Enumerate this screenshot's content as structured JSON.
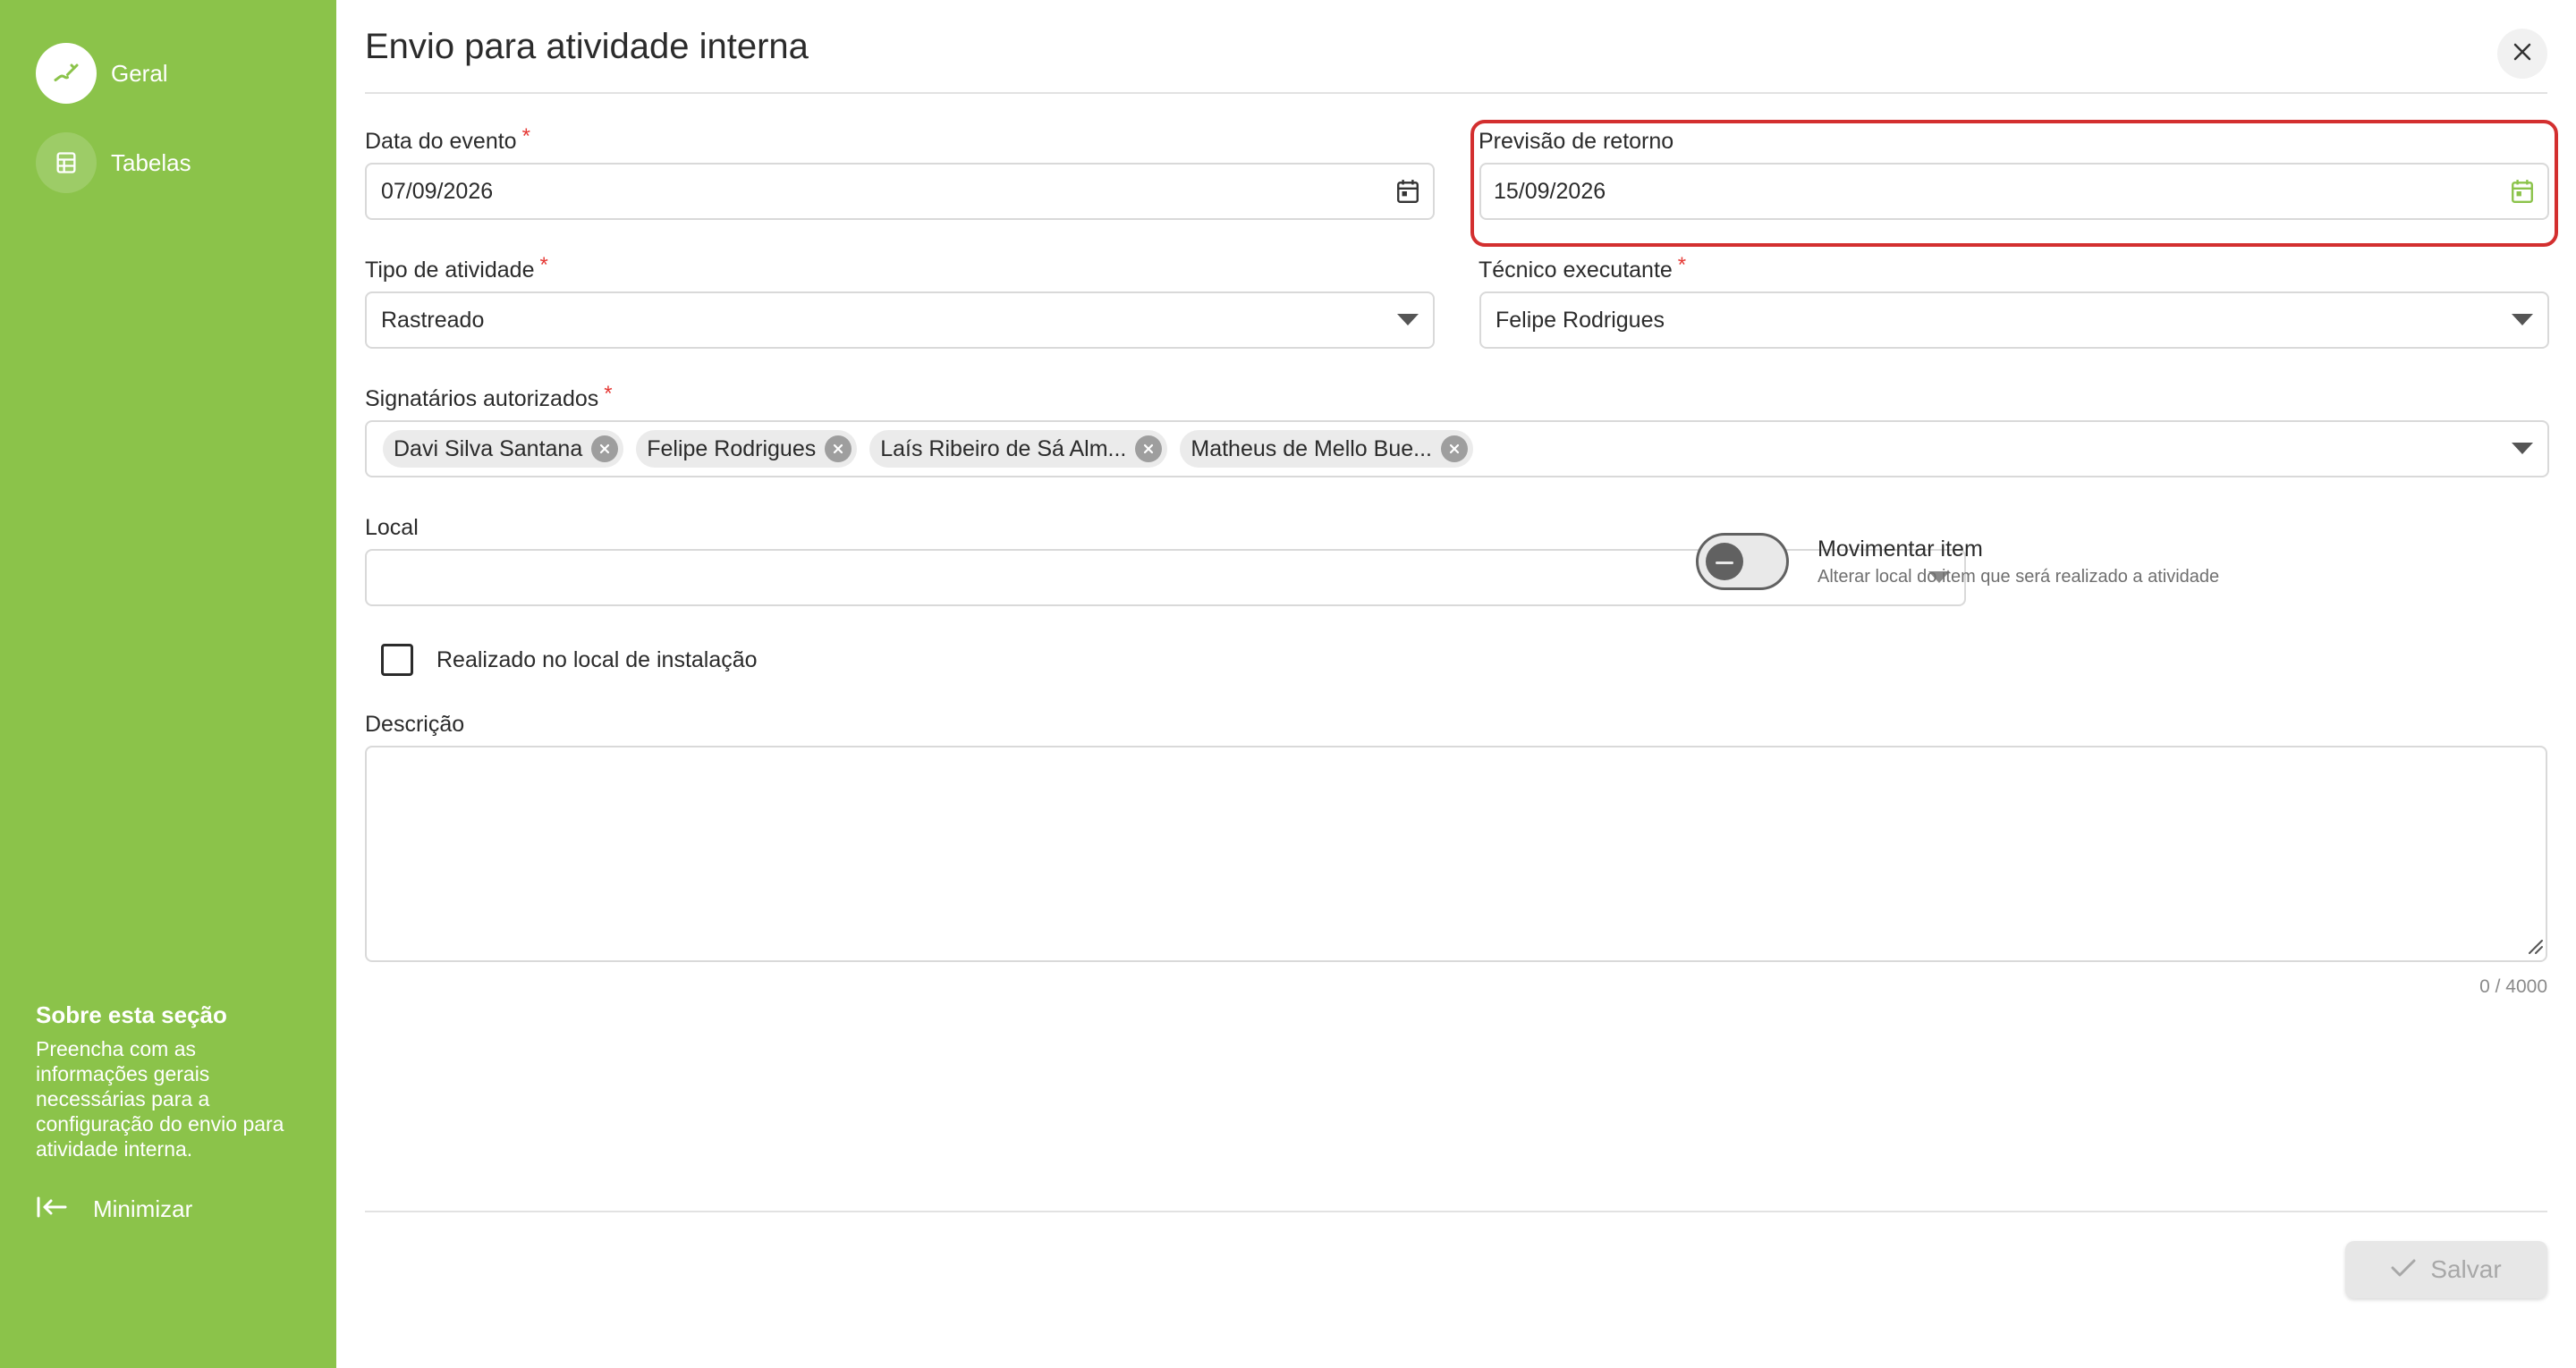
{
  "sidebar": {
    "items": [
      {
        "label": "Geral",
        "icon": "link-edit-icon",
        "active": true
      },
      {
        "label": "Tabelas",
        "icon": "table-icon",
        "active": false
      }
    ],
    "about_title": "Sobre esta seção",
    "about_text": "Preencha com as informações gerais necessárias para a configuração do envio para atividade interna.",
    "minimize_label": "Minimizar"
  },
  "dialog": {
    "title": "Envio para atividade interna",
    "close_icon": "close-icon"
  },
  "form": {
    "data_evento": {
      "label": "Data do evento",
      "required": "*",
      "value": "07/09/2026",
      "icon": "calendar-icon"
    },
    "previsao_retorno": {
      "label": "Previsão de retorno",
      "value": "15/09/2026",
      "icon": "calendar-icon"
    },
    "tipo_atividade": {
      "label": "Tipo de atividade",
      "required": "*",
      "value": "Rastreado"
    },
    "tecnico_executante": {
      "label": "Técnico executante",
      "required": "*",
      "value": "Felipe Rodrigues"
    },
    "signatarios": {
      "label": "Signatários autorizados",
      "required": "*",
      "chips": [
        "Davi Silva Santana",
        "Felipe Rodrigues",
        "Laís Ribeiro de Sá Alm...",
        "Matheus de Mello Bue..."
      ]
    },
    "local": {
      "label": "Local",
      "value": ""
    },
    "movimentar": {
      "title": "Movimentar item",
      "subtitle": "Alterar local do item que será realizado a atividade",
      "on": false
    },
    "realizado_local": {
      "label": "Realizado no local de instalação",
      "checked": false
    },
    "descricao": {
      "label": "Descrição",
      "value": "",
      "counter": "0 / 4000"
    }
  },
  "footer": {
    "save_label": "Salvar"
  },
  "colors": {
    "sidebar": "#8bc34a",
    "accent": "#8bc34a",
    "highlight": "#d32f2f",
    "required": "#e53935"
  }
}
